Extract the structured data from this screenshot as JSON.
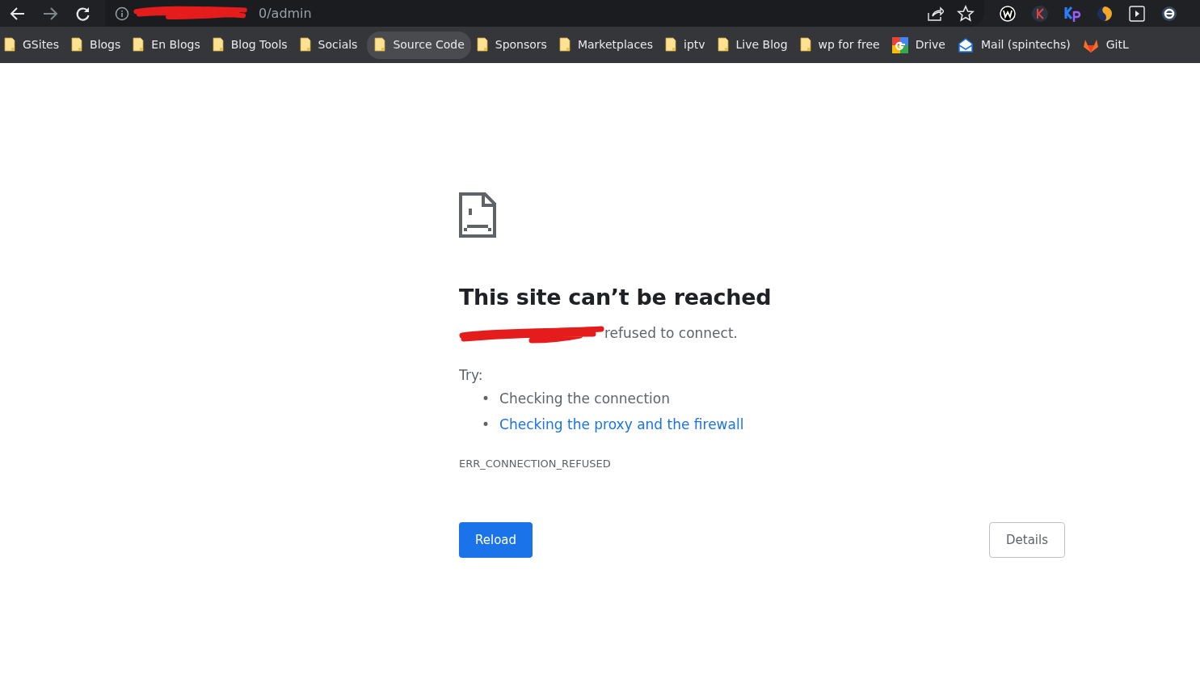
{
  "toolbar": {
    "url": "0/admin",
    "extensions": [
      {
        "kind": "w"
      },
      {
        "kind": "k"
      },
      {
        "kind": "kp"
      },
      {
        "kind": "moon"
      },
      {
        "kind": "player"
      },
      {
        "kind": "e"
      }
    ]
  },
  "bookmarks": [
    {
      "label": "GSites",
      "kind": "folder",
      "hovered": false
    },
    {
      "label": "Blogs",
      "kind": "folder",
      "hovered": false
    },
    {
      "label": "En Blogs",
      "kind": "folder",
      "hovered": false
    },
    {
      "label": "Blog Tools",
      "kind": "folder",
      "hovered": false
    },
    {
      "label": "Socials",
      "kind": "folder",
      "hovered": false
    },
    {
      "label": "Source Code",
      "kind": "folder",
      "hovered": true
    },
    {
      "label": "Sponsors",
      "kind": "folder",
      "hovered": false
    },
    {
      "label": "Marketplaces",
      "kind": "folder",
      "hovered": false
    },
    {
      "label": "iptv",
      "kind": "folder",
      "hovered": false
    },
    {
      "label": "Live Blog",
      "kind": "folder",
      "hovered": false
    },
    {
      "label": "wp for free",
      "kind": "folder",
      "hovered": false
    },
    {
      "label": "Drive",
      "kind": "google",
      "hovered": false
    },
    {
      "label": "Mail (spintechs)",
      "kind": "mail",
      "hovered": false
    },
    {
      "label": "GitL",
      "kind": "gitlab",
      "hovered": false
    }
  ],
  "error": {
    "title": "This site can’t be reached",
    "message": "refused to connect.",
    "try_label": "Try:",
    "suggestions": [
      {
        "marker": "•",
        "text": "Checking the connection",
        "kind": "text"
      },
      {
        "marker": "•",
        "text": "Checking the proxy and the firewall",
        "kind": "link"
      }
    ],
    "code": "ERR_CONNECTION_REFUSED",
    "reload": "Reload",
    "details": "Details"
  }
}
